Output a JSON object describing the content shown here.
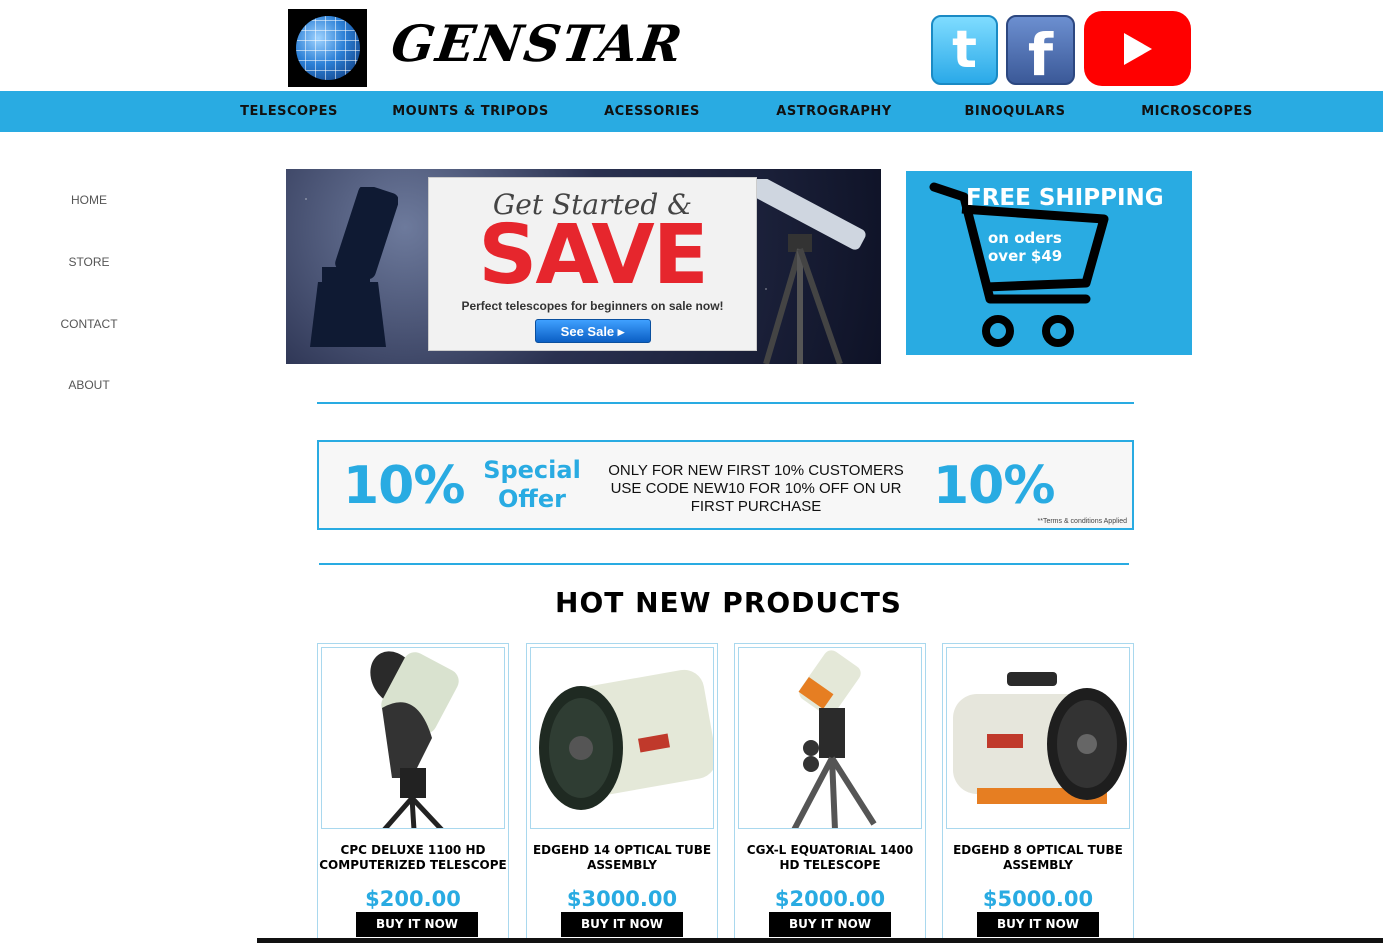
{
  "header": {
    "brand_name": "GENSTAR",
    "social": [
      {
        "name": "twitter",
        "glyph": "t"
      },
      {
        "name": "facebook",
        "glyph": "f"
      },
      {
        "name": "youtube",
        "glyph": ""
      }
    ]
  },
  "nav": {
    "items": [
      "TELESCOPES",
      "MOUNTS & TRIPODS",
      "ACESSORIES",
      "ASTROGRAPHY",
      "BINOQULARS",
      "MICROSCOPES"
    ]
  },
  "sidebar": {
    "items": [
      "HOME",
      "STORE",
      "CONTACT",
      "ABOUT"
    ]
  },
  "promo": {
    "sale_headline": "Get Started &",
    "sale_big": "SAVE",
    "sale_sub": "Perfect telescopes for beginners on sale now!",
    "sale_button": "See Sale",
    "shipping_title": "FREE SHIPPING",
    "shipping_line1": "on oders",
    "shipping_line2": "over $49"
  },
  "offer": {
    "percent_left": "10%",
    "special_line1": "Special",
    "special_line2": "Offer",
    "message": "ONLY FOR NEW FIRST 10% CUSTOMERS USE CODE NEW10 FOR 10% OFF ON UR FIRST PURCHASE",
    "percent_right": "10%",
    "terms": "**Terms & conditions Applied"
  },
  "products_section": {
    "title": "HOT NEW PRODUCTS",
    "items": [
      {
        "name": "CPC DELUXE 1100 HD COMPUTERIZED TELESCOPE",
        "price": "$200.00",
        "button": "BUY IT NOW"
      },
      {
        "name": "EDGEHD 14 OPTICAL TUBE ASSEMBLY",
        "price": "$3000.00",
        "button": "BUY IT NOW"
      },
      {
        "name": "CGX-L EQUATORIAL 1400 HD TELESCOPE",
        "price": "$2000.00",
        "button": "BUY IT NOW"
      },
      {
        "name": "EDGEHD 8 OPTICAL TUBE ASSEMBLY",
        "price": "$5000.00",
        "button": "BUY IT NOW"
      }
    ]
  },
  "colors": {
    "accent": "#29abe2",
    "sale_red": "#e6262d",
    "youtube_red": "#ff0000",
    "facebook_blue": "#3b5998"
  }
}
